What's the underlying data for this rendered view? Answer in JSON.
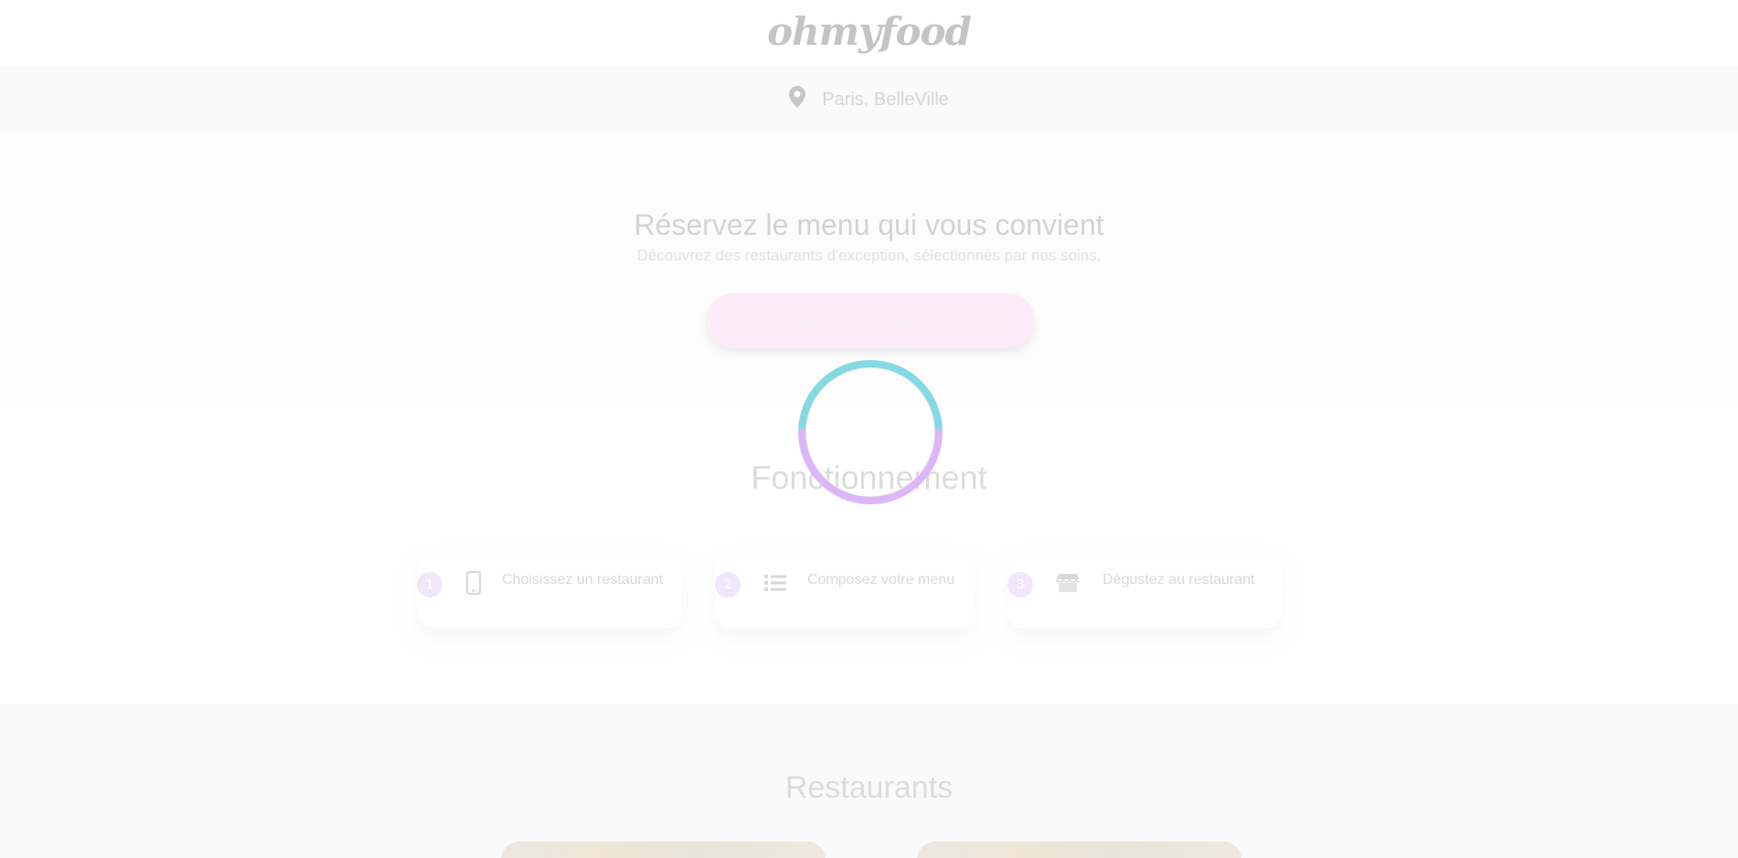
{
  "header": {
    "logo": "ohmyfood"
  },
  "location": {
    "icon": "map-pin-icon",
    "text": "Paris, BelleVille"
  },
  "hero": {
    "title": "Réservez le menu qui vous convient",
    "subtitle": "Découvrez des restaurants d'exception, sélectionnés par nos soins.",
    "cta_label": "Explorer nos restaurants"
  },
  "how_it_works": {
    "title": "Fonctionnement",
    "steps": [
      {
        "number": "1",
        "icon": "smartphone-icon",
        "label": "Choisissez un restaurant"
      },
      {
        "number": "2",
        "icon": "list-icon",
        "label": "Composez votre menu"
      },
      {
        "number": "3",
        "icon": "store-icon",
        "label": "Dégustez au restaurant"
      }
    ]
  },
  "restaurants": {
    "title": "Restaurants"
  },
  "loader": {
    "icon": "loading-spinner",
    "colors": [
      "#84d9e3",
      "#dcb7f8"
    ]
  }
}
